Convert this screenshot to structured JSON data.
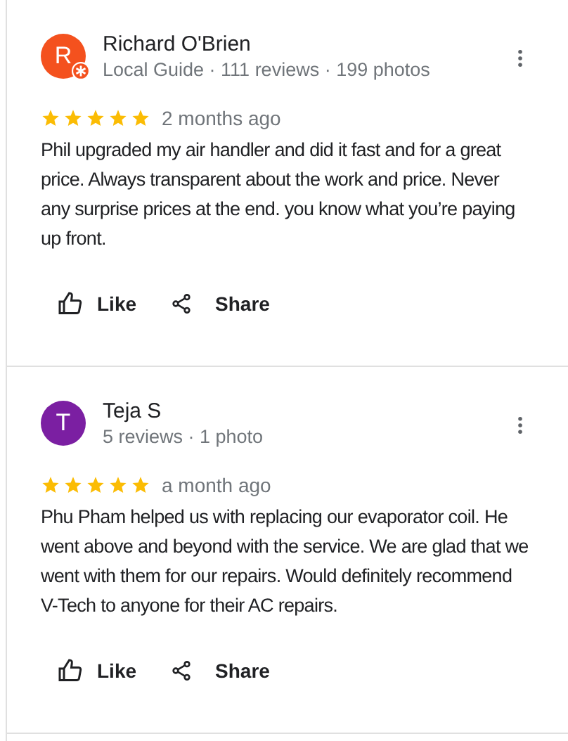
{
  "reviews": [
    {
      "initial": "R",
      "color": "#f4511e",
      "local_guide": true,
      "name": "Richard O'Brien",
      "meta": "Local Guide · 111 reviews · 199 photos",
      "stars": 5,
      "time": "2 months ago",
      "text": "Phil upgraded my air handler and did it fast and for a great price. Always transparent about the work and price. Never any surprise prices at the end. you know what you’re paying up front.",
      "like": "Like",
      "share": "Share"
    },
    {
      "initial": "T",
      "color": "#7b1fa2",
      "local_guide": false,
      "name": "Teja S",
      "meta": "5 reviews · 1 photo",
      "stars": 5,
      "time": "a month ago",
      "text": "Phu Pham helped us with replacing our evaporator coil. He went above and beyond with the service. We are glad that we went with them for our repairs. Would definitely recommend V-Tech to anyone for their AC repairs.",
      "like": "Like",
      "share": "Share"
    }
  ]
}
